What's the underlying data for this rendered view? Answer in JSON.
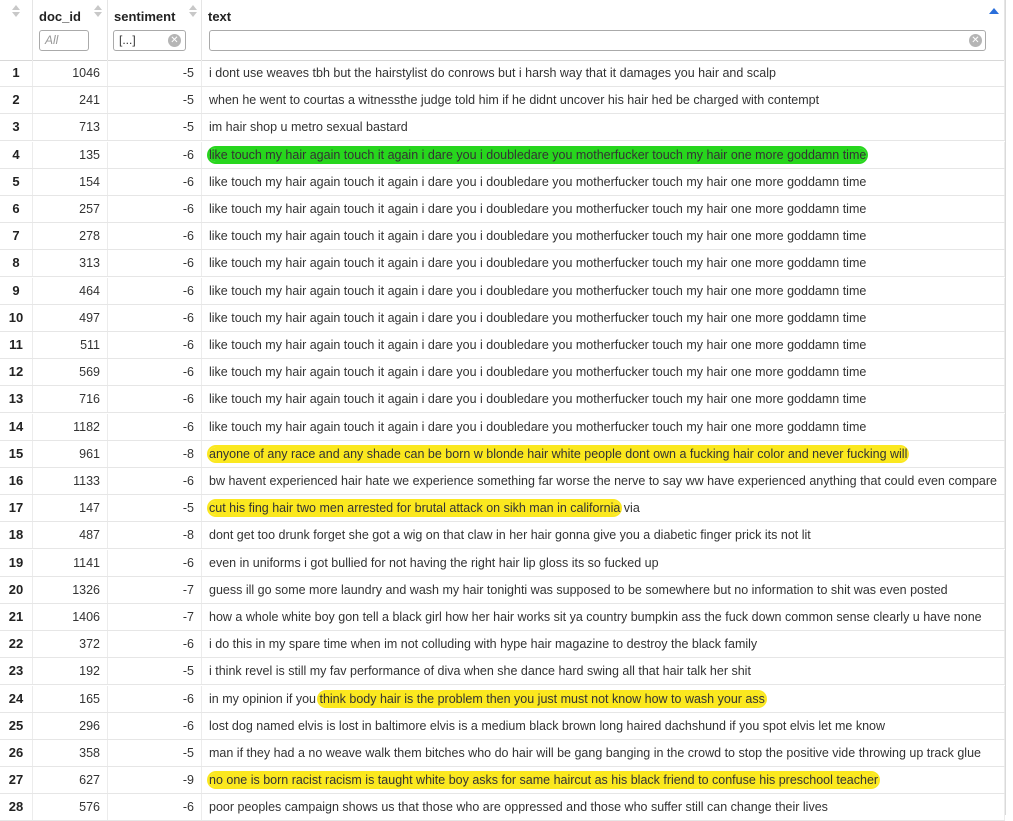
{
  "columns": {
    "doc_id": "doc_id",
    "sentiment": "sentiment",
    "text": "text"
  },
  "filters": {
    "doc_id_placeholder": "All",
    "sentiment_value": "[...]",
    "clear_glyph": "⊗",
    "text_value": ""
  },
  "highlight_colors": {
    "green": "#27d61d",
    "yellow": "#fbe81f"
  },
  "rows": [
    {
      "n": "1",
      "doc_id": "1046",
      "sentiment": "-5",
      "pre": " i dont use weaves tbh but the hairstylist do conrows but i  harsh way that it damages you hair and scalp",
      "hl": "",
      "post": "",
      "hl_color": ""
    },
    {
      "n": "2",
      "doc_id": "241",
      "sentiment": "-5",
      "pre": " when he went to courtas a witnessthe judge told him if he didnt uncover his hair hed be charged with contempt",
      "hl": "",
      "post": "",
      "hl_color": ""
    },
    {
      "n": "3",
      "doc_id": "713",
      "sentiment": "-5",
      "pre": "im  hair shop u metro sexual bastard",
      "hl": "",
      "post": "",
      "hl_color": ""
    },
    {
      "n": "4",
      "doc_id": "135",
      "sentiment": "-6",
      "pre": "",
      "hl": "like touch my hair again touch it again i dare you i doubledare you motherfucker touch my hair one more goddamn time",
      "post": "",
      "hl_color": "green"
    },
    {
      "n": "5",
      "doc_id": "154",
      "sentiment": "-6",
      "pre": "like touch my hair again touch it again i dare you i doubledare you motherfucker touch my hair one more goddamn time",
      "hl": "",
      "post": "",
      "hl_color": ""
    },
    {
      "n": "6",
      "doc_id": "257",
      "sentiment": "-6",
      "pre": "like touch my hair again touch it again i dare you i doubledare you motherfucker touch my hair one more goddamn time",
      "hl": "",
      "post": "",
      "hl_color": ""
    },
    {
      "n": "7",
      "doc_id": "278",
      "sentiment": "-6",
      "pre": "like touch my hair again touch it again i dare you i doubledare you motherfucker touch my hair one more goddamn time",
      "hl": "",
      "post": "",
      "hl_color": ""
    },
    {
      "n": "8",
      "doc_id": "313",
      "sentiment": "-6",
      "pre": "like touch my hair again touch it again i dare you i doubledare you motherfucker touch my hair one more goddamn time",
      "hl": "",
      "post": "",
      "hl_color": ""
    },
    {
      "n": "9",
      "doc_id": "464",
      "sentiment": "-6",
      "pre": "like touch my hair again touch it again i dare you i doubledare you motherfucker touch my hair one more goddamn time",
      "hl": "",
      "post": "",
      "hl_color": ""
    },
    {
      "n": "10",
      "doc_id": "497",
      "sentiment": "-6",
      "pre": "like touch my hair again touch it again i dare you i doubledare you motherfucker touch my hair one more goddamn time",
      "hl": "",
      "post": "",
      "hl_color": ""
    },
    {
      "n": "11",
      "doc_id": "511",
      "sentiment": "-6",
      "pre": "like touch my hair again touch it again i dare you i doubledare you motherfucker touch my hair one more goddamn time",
      "hl": "",
      "post": "",
      "hl_color": ""
    },
    {
      "n": "12",
      "doc_id": "569",
      "sentiment": "-6",
      "pre": "like touch my hair again touch it again i dare you i doubledare you motherfucker touch my hair one more goddamn time",
      "hl": "",
      "post": "",
      "hl_color": ""
    },
    {
      "n": "13",
      "doc_id": "716",
      "sentiment": "-6",
      "pre": "like touch my hair again touch it again i dare you i doubledare you motherfucker touch my hair one more goddamn time",
      "hl": "",
      "post": "",
      "hl_color": ""
    },
    {
      "n": "14",
      "doc_id": "1182",
      "sentiment": "-6",
      "pre": "like touch my hair again touch it again i dare you i doubledare you motherfucker touch my hair one more goddamn time",
      "hl": "",
      "post": "",
      "hl_color": ""
    },
    {
      "n": "15",
      "doc_id": "961",
      "sentiment": "-8",
      "pre": "",
      "hl": "anyone of any race and any shade can be born w blonde hair white people dont own a fucking hair color and never fucking will",
      "post": "",
      "hl_color": "yellow"
    },
    {
      "n": "16",
      "doc_id": "1133",
      "sentiment": "-6",
      "pre": "bw havent experienced hair hate we experience something far worse the nerve to say ww have experienced anything that could even compare",
      "hl": "",
      "post": "",
      "hl_color": ""
    },
    {
      "n": "17",
      "doc_id": "147",
      "sentiment": "-5",
      "pre": "",
      "hl": "cut his fing  hair  two men arrested for brutal attack on sikh man in california",
      "post": "   via",
      "hl_color": "yellow"
    },
    {
      "n": "18",
      "doc_id": "487",
      "sentiment": "-8",
      "pre": "dont get too drunk  forget she got a wig on that claw in her hair gonna give you a diabetic finger prick its not lit",
      "hl": "",
      "post": "",
      "hl_color": ""
    },
    {
      "n": "19",
      "doc_id": "1141",
      "sentiment": "-6",
      "pre": "even in uniforms i got bullied for not having the right hair lip gloss its so fucked up",
      "hl": "",
      "post": "",
      "hl_color": ""
    },
    {
      "n": "20",
      "doc_id": "1326",
      "sentiment": "-7",
      "pre": "guess ill go some more laundry and wash my hair tonighti was supposed to be somewhere but no information to shit was even posted",
      "hl": "",
      "post": "",
      "hl_color": ""
    },
    {
      "n": "21",
      "doc_id": "1406",
      "sentiment": "-7",
      "pre": "how a whole white boy gon tell a black girl how her hair works sit ya country bumpkin ass the fuck down common sense clearly u have none",
      "hl": "",
      "post": "",
      "hl_color": ""
    },
    {
      "n": "22",
      "doc_id": "372",
      "sentiment": "-6",
      "pre": "i do this in my spare time when im not colluding with hype hair magazine to destroy the black family",
      "hl": "",
      "post": "",
      "hl_color": ""
    },
    {
      "n": "23",
      "doc_id": "192",
      "sentiment": "-5",
      "pre": "i think revel is still my fav performance of diva  when she dance hard swing all that hair  talk her shit",
      "hl": "",
      "post": "",
      "hl_color": ""
    },
    {
      "n": "24",
      "doc_id": "165",
      "sentiment": "-6",
      "pre": "in my opinion if you ",
      "hl": "think body hair is the problem then you just must not know how to wash your ass",
      "post": "",
      "hl_color": "yellow"
    },
    {
      "n": "25",
      "doc_id": "296",
      "sentiment": "-6",
      "pre": "lost dog named elvis is lost in baltimore elvis is a medium black  brown long haired dachshund if you spot elvis let me know",
      "hl": "",
      "post": "",
      "hl_color": ""
    },
    {
      "n": "26",
      "doc_id": "358",
      "sentiment": "-5",
      "pre": "man if they had a no weave walk them bitches who do hair will be gang banging in the crowd to stop the positive vide throwing up track glue",
      "hl": "",
      "post": "",
      "hl_color": ""
    },
    {
      "n": "27",
      "doc_id": "627",
      "sentiment": "-9",
      "pre": "",
      "hl": "no one is born racist racism is taught white boy asks for same haircut as his black friend to confuse his preschool teacher",
      "post": "",
      "hl_color": "yellow"
    },
    {
      "n": "28",
      "doc_id": "576",
      "sentiment": "-6",
      "pre": "poor peoples campaign shows us that those who are oppressed and those who suffer still can change their lives",
      "hl": "",
      "post": "",
      "hl_color": ""
    }
  ]
}
